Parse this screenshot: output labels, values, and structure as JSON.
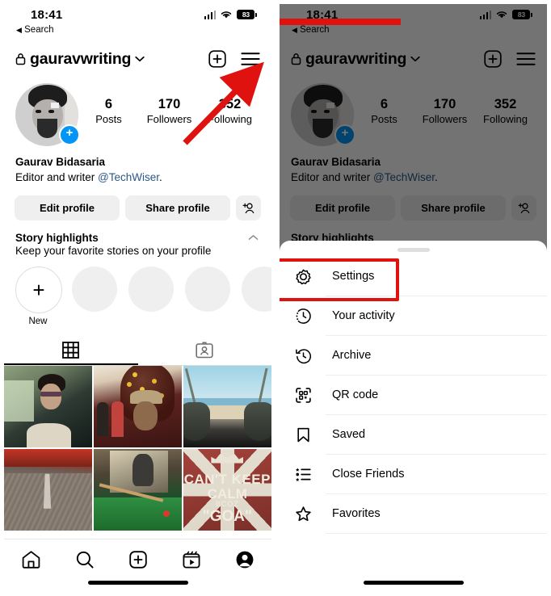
{
  "status_bar": {
    "time": "18:41",
    "back_label": "Search",
    "back_arrow": "◀",
    "battery_percent": "83",
    "signal_icon": "cellular-bars-icon",
    "wifi_icon": "wifi-icon",
    "battery_icon": "battery-icon"
  },
  "profile_header": {
    "lock_icon": "lock-icon",
    "username": "gauravwriting",
    "chevron_icon": "chevron-down-icon",
    "add_icon": "plus-square-icon",
    "menu_icon": "hamburger-menu-icon"
  },
  "profile": {
    "avatar_name": "profile-avatar",
    "add_story_badge": "+",
    "stats": [
      {
        "value": "6",
        "label": "Posts"
      },
      {
        "value": "170",
        "label": "Followers"
      },
      {
        "value": "352",
        "label": "Following"
      }
    ],
    "full_name": "Gaurav Bidasaria",
    "bio_prefix": "Editor and writer ",
    "bio_mention": "@TechWiser",
    "bio_suffix": "."
  },
  "actions": {
    "edit_profile": "Edit profile",
    "share_profile": "Share profile",
    "add_person_icon": "add-person-icon"
  },
  "story_highlights": {
    "title": "Story highlights",
    "subtitle": "Keep your favorite stories on your profile",
    "collapse_icon": "chevron-up-icon",
    "new_label": "New",
    "new_plus": "+",
    "placeholder_count": 4
  },
  "content_tabs": [
    {
      "name": "grid-tab",
      "icon": "grid-icon",
      "active": true
    },
    {
      "name": "tagged-tab",
      "icon": "tagged-person-icon",
      "active": false
    }
  ],
  "photo_grid": [
    {
      "name": "post-selfie-car",
      "alt": "Selfie in car with sunglasses"
    },
    {
      "name": "post-christmas-tree",
      "alt": "Selfie in front of Christmas tree wearing hat"
    },
    {
      "name": "post-beach-coconuts",
      "alt": "Coconut drinks on a beach"
    },
    {
      "name": "post-road",
      "alt": "Cobblestone road perspective"
    },
    {
      "name": "post-pool-table",
      "alt": "Billiards pool table"
    },
    {
      "name": "post-keep-calm",
      "alt": "Can't keep calm bcoz Goa poster"
    }
  ],
  "poster_text": {
    "line1": "CAN'T KEEP",
    "line2": "CALM",
    "line3": "BCOZ",
    "line4": "\"GOA\""
  },
  "bottom_nav": [
    {
      "name": "home-tab",
      "icon": "home-icon",
      "active": false
    },
    {
      "name": "search-tab",
      "icon": "search-icon",
      "active": false
    },
    {
      "name": "create-tab",
      "icon": "plus-square-icon",
      "active": false
    },
    {
      "name": "reels-tab",
      "icon": "reels-icon",
      "active": false
    },
    {
      "name": "profile-tab",
      "icon": "person-filled-icon",
      "active": true
    }
  ],
  "menu_sheet": {
    "handle": "drag-handle",
    "items": [
      {
        "label": "Settings",
        "icon": "gear-icon",
        "highlighted": true
      },
      {
        "label": "Your activity",
        "icon": "activity-clock-icon",
        "highlighted": false
      },
      {
        "label": "Archive",
        "icon": "archive-clock-icon",
        "highlighted": false
      },
      {
        "label": "QR code",
        "icon": "qr-code-icon",
        "highlighted": false
      },
      {
        "label": "Saved",
        "icon": "bookmark-icon",
        "highlighted": false
      },
      {
        "label": "Close Friends",
        "icon": "close-friends-list-icon",
        "highlighted": false
      },
      {
        "label": "Favorites",
        "icon": "star-icon",
        "highlighted": false
      }
    ]
  },
  "annotations": {
    "arrow_color": "#e0120f",
    "highlight_color": "#e0120f",
    "arrow_target": "hamburger-menu-icon",
    "highlight_target": "Settings"
  }
}
